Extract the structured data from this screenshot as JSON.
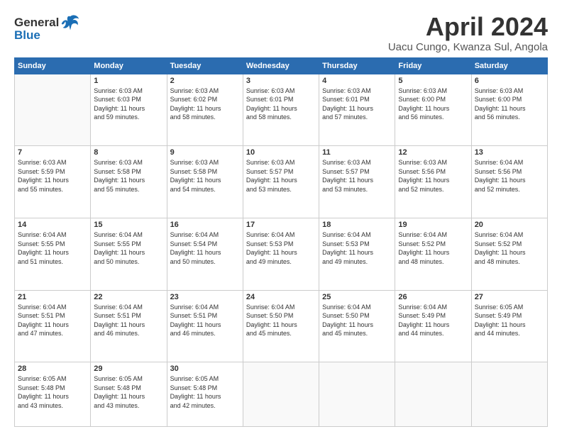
{
  "header": {
    "logo_general": "General",
    "logo_blue": "Blue",
    "month": "April 2024",
    "location": "Uacu Cungo, Kwanza Sul, Angola"
  },
  "weekdays": [
    "Sunday",
    "Monday",
    "Tuesday",
    "Wednesday",
    "Thursday",
    "Friday",
    "Saturday"
  ],
  "weeks": [
    [
      {
        "day": "",
        "info": ""
      },
      {
        "day": "1",
        "info": "Sunrise: 6:03 AM\nSunset: 6:03 PM\nDaylight: 11 hours\nand 59 minutes."
      },
      {
        "day": "2",
        "info": "Sunrise: 6:03 AM\nSunset: 6:02 PM\nDaylight: 11 hours\nand 58 minutes."
      },
      {
        "day": "3",
        "info": "Sunrise: 6:03 AM\nSunset: 6:01 PM\nDaylight: 11 hours\nand 58 minutes."
      },
      {
        "day": "4",
        "info": "Sunrise: 6:03 AM\nSunset: 6:01 PM\nDaylight: 11 hours\nand 57 minutes."
      },
      {
        "day": "5",
        "info": "Sunrise: 6:03 AM\nSunset: 6:00 PM\nDaylight: 11 hours\nand 56 minutes."
      },
      {
        "day": "6",
        "info": "Sunrise: 6:03 AM\nSunset: 6:00 PM\nDaylight: 11 hours\nand 56 minutes."
      }
    ],
    [
      {
        "day": "7",
        "info": "Sunrise: 6:03 AM\nSunset: 5:59 PM\nDaylight: 11 hours\nand 55 minutes."
      },
      {
        "day": "8",
        "info": "Sunrise: 6:03 AM\nSunset: 5:58 PM\nDaylight: 11 hours\nand 55 minutes."
      },
      {
        "day": "9",
        "info": "Sunrise: 6:03 AM\nSunset: 5:58 PM\nDaylight: 11 hours\nand 54 minutes."
      },
      {
        "day": "10",
        "info": "Sunrise: 6:03 AM\nSunset: 5:57 PM\nDaylight: 11 hours\nand 53 minutes."
      },
      {
        "day": "11",
        "info": "Sunrise: 6:03 AM\nSunset: 5:57 PM\nDaylight: 11 hours\nand 53 minutes."
      },
      {
        "day": "12",
        "info": "Sunrise: 6:03 AM\nSunset: 5:56 PM\nDaylight: 11 hours\nand 52 minutes."
      },
      {
        "day": "13",
        "info": "Sunrise: 6:04 AM\nSunset: 5:56 PM\nDaylight: 11 hours\nand 52 minutes."
      }
    ],
    [
      {
        "day": "14",
        "info": "Sunrise: 6:04 AM\nSunset: 5:55 PM\nDaylight: 11 hours\nand 51 minutes."
      },
      {
        "day": "15",
        "info": "Sunrise: 6:04 AM\nSunset: 5:55 PM\nDaylight: 11 hours\nand 50 minutes."
      },
      {
        "day": "16",
        "info": "Sunrise: 6:04 AM\nSunset: 5:54 PM\nDaylight: 11 hours\nand 50 minutes."
      },
      {
        "day": "17",
        "info": "Sunrise: 6:04 AM\nSunset: 5:53 PM\nDaylight: 11 hours\nand 49 minutes."
      },
      {
        "day": "18",
        "info": "Sunrise: 6:04 AM\nSunset: 5:53 PM\nDaylight: 11 hours\nand 49 minutes."
      },
      {
        "day": "19",
        "info": "Sunrise: 6:04 AM\nSunset: 5:52 PM\nDaylight: 11 hours\nand 48 minutes."
      },
      {
        "day": "20",
        "info": "Sunrise: 6:04 AM\nSunset: 5:52 PM\nDaylight: 11 hours\nand 48 minutes."
      }
    ],
    [
      {
        "day": "21",
        "info": "Sunrise: 6:04 AM\nSunset: 5:51 PM\nDaylight: 11 hours\nand 47 minutes."
      },
      {
        "day": "22",
        "info": "Sunrise: 6:04 AM\nSunset: 5:51 PM\nDaylight: 11 hours\nand 46 minutes."
      },
      {
        "day": "23",
        "info": "Sunrise: 6:04 AM\nSunset: 5:51 PM\nDaylight: 11 hours\nand 46 minutes."
      },
      {
        "day": "24",
        "info": "Sunrise: 6:04 AM\nSunset: 5:50 PM\nDaylight: 11 hours\nand 45 minutes."
      },
      {
        "day": "25",
        "info": "Sunrise: 6:04 AM\nSunset: 5:50 PM\nDaylight: 11 hours\nand 45 minutes."
      },
      {
        "day": "26",
        "info": "Sunrise: 6:04 AM\nSunset: 5:49 PM\nDaylight: 11 hours\nand 44 minutes."
      },
      {
        "day": "27",
        "info": "Sunrise: 6:05 AM\nSunset: 5:49 PM\nDaylight: 11 hours\nand 44 minutes."
      }
    ],
    [
      {
        "day": "28",
        "info": "Sunrise: 6:05 AM\nSunset: 5:48 PM\nDaylight: 11 hours\nand 43 minutes."
      },
      {
        "day": "29",
        "info": "Sunrise: 6:05 AM\nSunset: 5:48 PM\nDaylight: 11 hours\nand 43 minutes."
      },
      {
        "day": "30",
        "info": "Sunrise: 6:05 AM\nSunset: 5:48 PM\nDaylight: 11 hours\nand 42 minutes."
      },
      {
        "day": "",
        "info": ""
      },
      {
        "day": "",
        "info": ""
      },
      {
        "day": "",
        "info": ""
      },
      {
        "day": "",
        "info": ""
      }
    ]
  ]
}
